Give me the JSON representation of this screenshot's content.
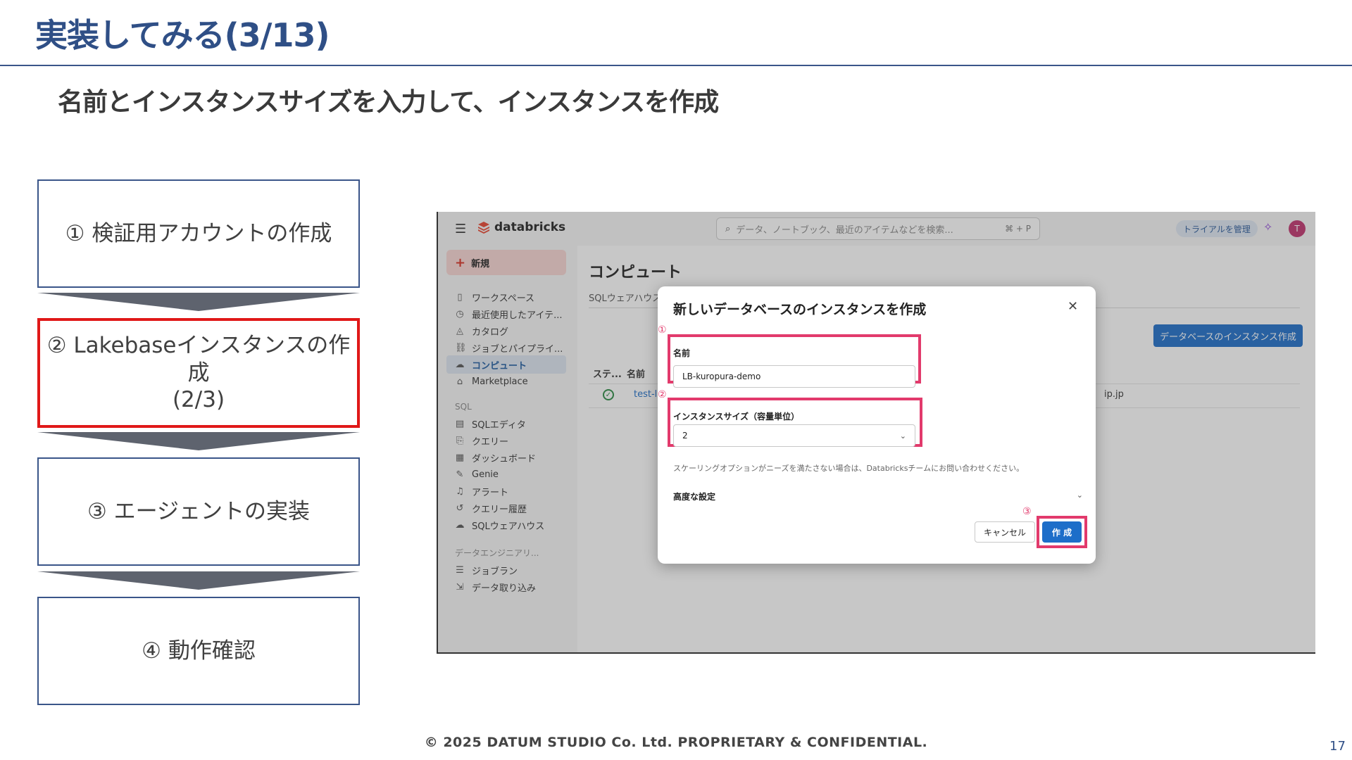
{
  "slide": {
    "title": "実装してみる(3/13)",
    "subtitle": "名前とインスタンスサイズを入力して、インスタンスを作成",
    "footer": "© 2025 DATUM STUDIO Co. Ltd. PROPRIETARY & CONFIDENTIAL.",
    "page_number": "17"
  },
  "steps": [
    {
      "label": "① 検証用アカウントの作成",
      "active": false
    },
    {
      "label": "② Lakebaseインスタンスの作成",
      "label2": "(2/3)",
      "active": true
    },
    {
      "label": "③ エージェントの実装",
      "active": false
    },
    {
      "label": "④ 動作確認",
      "active": false
    }
  ],
  "screenshot": {
    "topbar": {
      "logo": "databricks",
      "search_placeholder": "データ、ノートブック、最近のアイテムなどを検索...",
      "search_shortcut": "⌘ + P",
      "trial_label": "トライアルを管理",
      "avatar_initial": "T"
    },
    "sidebar": {
      "new_label": "新規",
      "items": [
        {
          "icon": "workspace-icon",
          "label": "ワークスペース"
        },
        {
          "icon": "clock-icon",
          "label": "最近使用したアイテ..."
        },
        {
          "icon": "catalog-icon",
          "label": "カタログ"
        },
        {
          "icon": "jobs-icon",
          "label": "ジョブとパイプライ..."
        },
        {
          "icon": "cloud-icon",
          "label": "コンピュート"
        },
        {
          "icon": "marketplace-icon",
          "label": "Marketplace"
        }
      ],
      "section_sql": "SQL",
      "sql_items": [
        {
          "icon": "editor-icon",
          "label": "SQLエディタ"
        },
        {
          "icon": "query-icon",
          "label": "クエリー"
        },
        {
          "icon": "dashboard-icon",
          "label": "ダッシュボード"
        },
        {
          "icon": "genie-icon",
          "label": "Genie"
        },
        {
          "icon": "bell-icon",
          "label": "アラート"
        },
        {
          "icon": "history-icon",
          "label": "クエリー履歴"
        },
        {
          "icon": "warehouse-icon",
          "label": "SQLウェアハウス"
        }
      ],
      "section_de": "データエンジニアリ...",
      "de_items": [
        {
          "icon": "jobrun-icon",
          "label": "ジョブラン"
        },
        {
          "icon": "ingest-icon",
          "label": "データ取り込み"
        }
      ]
    },
    "main": {
      "heading": "コンピュート",
      "tab": "SQLウェアハウス",
      "create_db_button": "データベースのインスタンス作成",
      "col_status": "ステ...",
      "col_name": "名前",
      "row_link": "test-la",
      "row_owner": "ip.jp"
    },
    "modal": {
      "title": "新しいデータベースのインスタンスを作成",
      "marker1": "①",
      "marker2": "②",
      "marker3": "③",
      "name_label": "名前",
      "name_value": "LB-kuropura-demo",
      "size_label": "インスタンスサイズ（容量単位）",
      "size_value": "2",
      "helper": "スケーリングオプションがニーズを満たさない場合は、Databricksチームにお問い合わせください。",
      "advanced_label": "高度な設定",
      "cancel_label": "キャンセル",
      "create_label": "作 成"
    }
  }
}
